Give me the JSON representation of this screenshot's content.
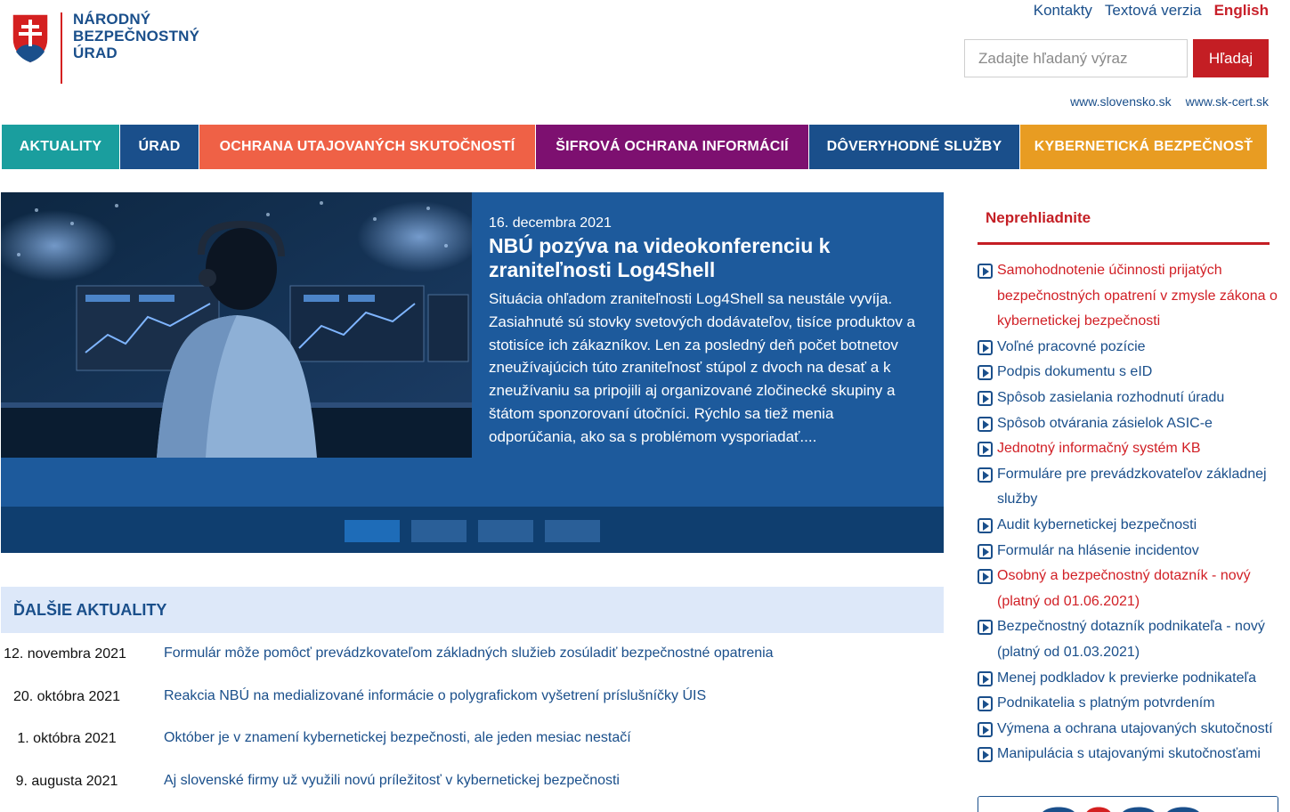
{
  "header": {
    "logo_lines": [
      "NÁRODNÝ",
      "BEZPEČNOSTNÝ",
      "ÚRAD"
    ],
    "top_links": [
      "Kontakty",
      "Textová verzia",
      "English"
    ],
    "search_placeholder": "Zadajte hľadaný výraz",
    "search_button": "Hľadaj",
    "ext_links": [
      "www.slovensko.sk",
      "www.sk-cert.sk"
    ]
  },
  "nav": [
    {
      "label": "AKTUALITY",
      "color": "#1a9e9e"
    },
    {
      "label": "ÚRAD",
      "color": "#1a4f8b"
    },
    {
      "label": "OCHRANA UTAJOVANÝCH SKUTOČNOSTÍ",
      "color": "#ef6146"
    },
    {
      "label": "ŠIFROVÁ OCHRANA INFORMÁCIÍ",
      "color": "#7d1070"
    },
    {
      "label": "DÔVERYHODNÉ SLUŽBY",
      "color": "#1a4f8b"
    },
    {
      "label": "KYBERNETICKÁ BEZPEČNOSŤ",
      "color": "#e89c22"
    }
  ],
  "slider": {
    "date": "16. decembra 2021",
    "title": "NBÚ pozýva na videokonferenciu k zraniteľnosti Log4Shell",
    "body": "Situácia ohľadom zraniteľnosti Log4Shell sa neustále vyvíja. Zasiahnuté sú stovky svetových dodávateľov, tisíce produktov a stotisíce ich zákazníkov. Len za posledný deň počet botnetov zneužívajúcich túto zraniteľnosť stúpol z dvoch na desať a k zneužívaniu sa pripojili aj organizované zločinecké skupiny a štátom sponzorovaní útočníci. Rýchlo sa tiež menia odporúčania, ako sa s problémom vysporiadať....",
    "dots_count": 4,
    "active_dot": 1
  },
  "news": {
    "heading": "ĎALŠIE AKTUALITY",
    "items": [
      {
        "date": "12. novembra 2021",
        "title": "Formulár môže pomôcť prevádzkovateľom základných služieb zosúladiť bezpečnostné opatrenia"
      },
      {
        "date": "20. októbra 2021",
        "title": "Reakcia NBÚ na medializované informácie o polygrafickom vyšetrení príslušníčky ÚIS"
      },
      {
        "date": "1. októbra 2021",
        "title": "Október je v znamení kybernetickej bezpečnosti, ale jeden mesiac nestačí"
      },
      {
        "date": "9. augusta 2021",
        "title": "Aj slovenské firmy už využili novú príležitosť v kybernetickej bezpečnosti"
      }
    ]
  },
  "sidebar": {
    "heading": "Neprehliadnite",
    "items": [
      {
        "text": "Samohodnotenie účinnosti prijatých bezpečnostných opatrení v zmysle zákona o kybernetickej bezpečnosti",
        "color": "red"
      },
      {
        "text": "Voľné pracovné pozície",
        "color": "blue"
      },
      {
        "text": "Podpis dokumentu s eID",
        "color": "blue"
      },
      {
        "text": "Spôsob zasielania rozhodnutí úradu",
        "color": "blue"
      },
      {
        "text": "Spôsob otvárania zásielok ASIC-e",
        "color": "blue"
      },
      {
        "text": "Jednotný informačný systém KB",
        "color": "red"
      },
      {
        "text": "Formuláre pre prevádzkovateľov základnej služby",
        "color": "blue"
      },
      {
        "text": "Audit kybernetickej bezpečnosti",
        "color": "blue"
      },
      {
        "text": "Formulár na hlásenie incidentov",
        "color": "blue"
      },
      {
        "text": "Osobný a bezpečnostný dotazník - nový (platný od 01.06.2021)",
        "color": "red"
      },
      {
        "text": "Bezpečnostný dotazník podnikateľa - nový (platný od 01.03.2021)",
        "color": "blue"
      },
      {
        "text": "Menej podkladov k previerke podnikateľa",
        "color": "blue"
      },
      {
        "text": "Podnikatelia s platným potvrdením",
        "color": "blue"
      },
      {
        "text": "Výmena a ochrana utajovaných skutočností",
        "color": "blue"
      },
      {
        "text": "Manipulácia s utajovanými skutočnosťami",
        "color": "blue"
      }
    ]
  }
}
